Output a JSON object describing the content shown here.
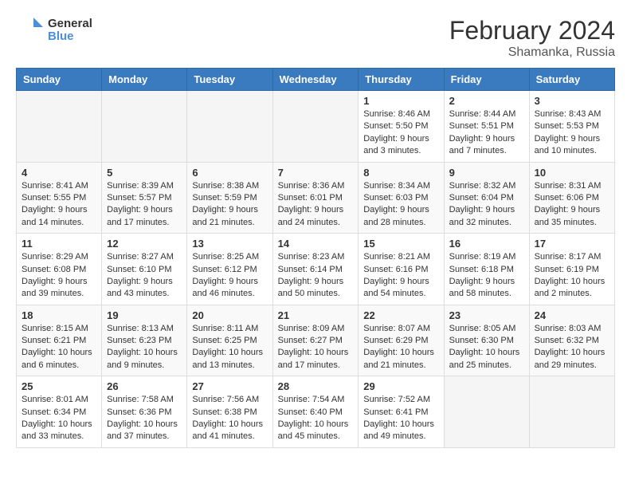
{
  "logo": {
    "text_general": "General",
    "text_blue": "Blue"
  },
  "header": {
    "month_title": "February 2024",
    "location": "Shamanka, Russia"
  },
  "weekdays": [
    "Sunday",
    "Monday",
    "Tuesday",
    "Wednesday",
    "Thursday",
    "Friday",
    "Saturday"
  ],
  "weeks": [
    [
      {
        "day": "",
        "info": ""
      },
      {
        "day": "",
        "info": ""
      },
      {
        "day": "",
        "info": ""
      },
      {
        "day": "",
        "info": ""
      },
      {
        "day": "1",
        "info": "Sunrise: 8:46 AM\nSunset: 5:50 PM\nDaylight: 9 hours and 3 minutes."
      },
      {
        "day": "2",
        "info": "Sunrise: 8:44 AM\nSunset: 5:51 PM\nDaylight: 9 hours and 7 minutes."
      },
      {
        "day": "3",
        "info": "Sunrise: 8:43 AM\nSunset: 5:53 PM\nDaylight: 9 hours and 10 minutes."
      }
    ],
    [
      {
        "day": "4",
        "info": "Sunrise: 8:41 AM\nSunset: 5:55 PM\nDaylight: 9 hours and 14 minutes."
      },
      {
        "day": "5",
        "info": "Sunrise: 8:39 AM\nSunset: 5:57 PM\nDaylight: 9 hours and 17 minutes."
      },
      {
        "day": "6",
        "info": "Sunrise: 8:38 AM\nSunset: 5:59 PM\nDaylight: 9 hours and 21 minutes."
      },
      {
        "day": "7",
        "info": "Sunrise: 8:36 AM\nSunset: 6:01 PM\nDaylight: 9 hours and 24 minutes."
      },
      {
        "day": "8",
        "info": "Sunrise: 8:34 AM\nSunset: 6:03 PM\nDaylight: 9 hours and 28 minutes."
      },
      {
        "day": "9",
        "info": "Sunrise: 8:32 AM\nSunset: 6:04 PM\nDaylight: 9 hours and 32 minutes."
      },
      {
        "day": "10",
        "info": "Sunrise: 8:31 AM\nSunset: 6:06 PM\nDaylight: 9 hours and 35 minutes."
      }
    ],
    [
      {
        "day": "11",
        "info": "Sunrise: 8:29 AM\nSunset: 6:08 PM\nDaylight: 9 hours and 39 minutes."
      },
      {
        "day": "12",
        "info": "Sunrise: 8:27 AM\nSunset: 6:10 PM\nDaylight: 9 hours and 43 minutes."
      },
      {
        "day": "13",
        "info": "Sunrise: 8:25 AM\nSunset: 6:12 PM\nDaylight: 9 hours and 46 minutes."
      },
      {
        "day": "14",
        "info": "Sunrise: 8:23 AM\nSunset: 6:14 PM\nDaylight: 9 hours and 50 minutes."
      },
      {
        "day": "15",
        "info": "Sunrise: 8:21 AM\nSunset: 6:16 PM\nDaylight: 9 hours and 54 minutes."
      },
      {
        "day": "16",
        "info": "Sunrise: 8:19 AM\nSunset: 6:18 PM\nDaylight: 9 hours and 58 minutes."
      },
      {
        "day": "17",
        "info": "Sunrise: 8:17 AM\nSunset: 6:19 PM\nDaylight: 10 hours and 2 minutes."
      }
    ],
    [
      {
        "day": "18",
        "info": "Sunrise: 8:15 AM\nSunset: 6:21 PM\nDaylight: 10 hours and 6 minutes."
      },
      {
        "day": "19",
        "info": "Sunrise: 8:13 AM\nSunset: 6:23 PM\nDaylight: 10 hours and 9 minutes."
      },
      {
        "day": "20",
        "info": "Sunrise: 8:11 AM\nSunset: 6:25 PM\nDaylight: 10 hours and 13 minutes."
      },
      {
        "day": "21",
        "info": "Sunrise: 8:09 AM\nSunset: 6:27 PM\nDaylight: 10 hours and 17 minutes."
      },
      {
        "day": "22",
        "info": "Sunrise: 8:07 AM\nSunset: 6:29 PM\nDaylight: 10 hours and 21 minutes."
      },
      {
        "day": "23",
        "info": "Sunrise: 8:05 AM\nSunset: 6:30 PM\nDaylight: 10 hours and 25 minutes."
      },
      {
        "day": "24",
        "info": "Sunrise: 8:03 AM\nSunset: 6:32 PM\nDaylight: 10 hours and 29 minutes."
      }
    ],
    [
      {
        "day": "25",
        "info": "Sunrise: 8:01 AM\nSunset: 6:34 PM\nDaylight: 10 hours and 33 minutes."
      },
      {
        "day": "26",
        "info": "Sunrise: 7:58 AM\nSunset: 6:36 PM\nDaylight: 10 hours and 37 minutes."
      },
      {
        "day": "27",
        "info": "Sunrise: 7:56 AM\nSunset: 6:38 PM\nDaylight: 10 hours and 41 minutes."
      },
      {
        "day": "28",
        "info": "Sunrise: 7:54 AM\nSunset: 6:40 PM\nDaylight: 10 hours and 45 minutes."
      },
      {
        "day": "29",
        "info": "Sunrise: 7:52 AM\nSunset: 6:41 PM\nDaylight: 10 hours and 49 minutes."
      },
      {
        "day": "",
        "info": ""
      },
      {
        "day": "",
        "info": ""
      }
    ]
  ]
}
